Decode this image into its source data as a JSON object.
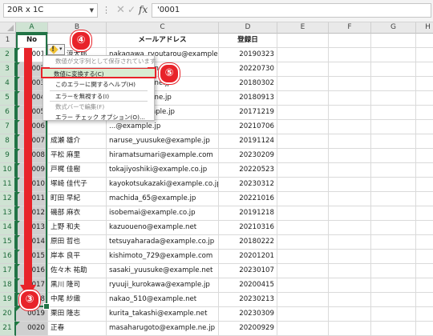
{
  "formula_bar": {
    "name_box": "20R x 1C",
    "fx_label": "fx",
    "formula": "'0001"
  },
  "columns": [
    "A",
    "B",
    "C",
    "D",
    "E",
    "F",
    "G",
    "H"
  ],
  "header_row": {
    "no": "No",
    "name": "",
    "email": "メールアドレス",
    "date": "登録日"
  },
  "rows": [
    {
      "row": "2",
      "no": "0001",
      "name": "中野 涼太郎",
      "email": "nakagawa_ryoutarou@example.net",
      "date": "20190323"
    },
    {
      "row": "3",
      "no": "0002",
      "name": "",
      "email": "...@example.ne.jp",
      "date": "20220730"
    },
    {
      "row": "4",
      "no": "0003",
      "name": "",
      "email": "...@example.ne.jp",
      "date": "20180302"
    },
    {
      "row": "5",
      "no": "0004",
      "name": "",
      "email": "...@example.ne.jp",
      "date": "20180913"
    },
    {
      "row": "6",
      "no": "0005",
      "name": "",
      "email": "...awa@example.jp",
      "date": "20171219"
    },
    {
      "row": "7",
      "no": "0006",
      "name": "",
      "email": "...@example.jp",
      "date": "20210706"
    },
    {
      "row": "8",
      "no": "0007",
      "name": "成瀬 雄介",
      "email": "naruse_yuusuke@example.jp",
      "date": "20191124"
    },
    {
      "row": "9",
      "no": "0008",
      "name": "平松 麻里",
      "email": "hiramatsumari@example.com",
      "date": "20230209"
    },
    {
      "row": "10",
      "no": "0009",
      "name": "戸梶 佳樹",
      "email": "tokajiyoshiki@example.co.jp",
      "date": "20220523"
    },
    {
      "row": "11",
      "no": "0010",
      "name": "塚崎 佳代子",
      "email": "kayokotsukazaki@example.co.jp",
      "date": "20230312"
    },
    {
      "row": "12",
      "no": "0011",
      "name": "町田 早紀",
      "email": "machida_65@example.jp",
      "date": "20221016"
    },
    {
      "row": "13",
      "no": "0012",
      "name": "磯部 麻衣",
      "email": "isobemai@example.co.jp",
      "date": "20191218"
    },
    {
      "row": "14",
      "no": "0013",
      "name": "上野 和夫",
      "email": "kazuoueno@example.net",
      "date": "20210316"
    },
    {
      "row": "15",
      "no": "0014",
      "name": "原田 哲也",
      "email": "tetsuyaharada@example.co.jp",
      "date": "20180222"
    },
    {
      "row": "16",
      "no": "0015",
      "name": "岸本 良平",
      "email": "kishimoto_729@example.com",
      "date": "20201201"
    },
    {
      "row": "17",
      "no": "0016",
      "name": "佐々木 祐助",
      "email": "sasaki_yuusuke@example.net",
      "date": "20230107"
    },
    {
      "row": "18",
      "no": "0017",
      "name": "黒川 隆司",
      "email": "ryuuji_kurokawa@example.jp",
      "date": "20200415"
    },
    {
      "row": "19",
      "no": "0018",
      "name": "中尾 紗織",
      "email": "nakao_510@example.net",
      "date": "20230213"
    },
    {
      "row": "20",
      "no": "0019",
      "name": "栗田 隆志",
      "email": "kurita_takashi@example.net",
      "date": "20230309"
    },
    {
      "row": "21",
      "no": "0020",
      "name": "正春",
      "email": "masaharugoto@example.ne.jp",
      "date": "20200929"
    }
  ],
  "context_menu": {
    "items": [
      {
        "label": "数値が文字列として保存されています",
        "disabled": true,
        "highlight": false
      },
      {
        "label": "数値に変換する(C)",
        "disabled": false,
        "highlight": true
      },
      {
        "label": "このエラーに関するヘルプ(H)",
        "disabled": false,
        "highlight": false
      },
      {
        "label": "エラーを無視する(I)",
        "disabled": false,
        "highlight": false
      },
      {
        "label": "数式バーで編集(F)",
        "disabled": true,
        "highlight": false
      },
      {
        "label": "エラー チェック オプション(O)...",
        "disabled": false,
        "highlight": false
      }
    ]
  },
  "callouts": {
    "three": "③",
    "four": "④",
    "five": "⑤"
  },
  "colors": {
    "accent": "#e8232a",
    "excel_green": "#217346",
    "error_triangle": "#1e7b3e"
  }
}
